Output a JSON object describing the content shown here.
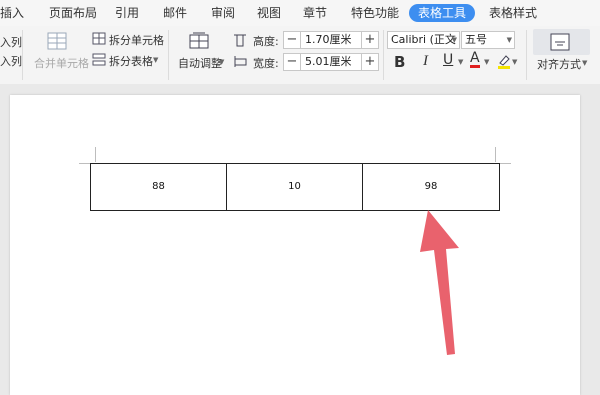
{
  "menu": {
    "tabs": [
      "插入",
      "页面布局",
      "引用",
      "邮件",
      "审阅",
      "视图",
      "章节",
      "特色功能",
      "表格工具",
      "表格样式"
    ],
    "active_tab": "表格工具"
  },
  "ribbon": {
    "left_partial_1": "入列",
    "left_partial_2": "入列",
    "merge_cells": "合并单元格",
    "split_cells": "拆分单元格",
    "split_table": "拆分表格",
    "autofit": "自动调整",
    "height_label": "高度:",
    "height_value": "1.70厘米",
    "width_label": "宽度:",
    "width_value": "5.01厘米",
    "font_name": "Calibri (正文",
    "font_size": "五号",
    "bold": "B",
    "italic": "I",
    "underline": "U",
    "font_color": "A",
    "align": "对齐方式",
    "colors": {
      "font_color": "#e02020",
      "highlight": "#f5e400",
      "accent": "#3d8ef0",
      "arrow": "#e9626d"
    }
  },
  "table": {
    "cells": [
      "88",
      "10",
      "98"
    ]
  }
}
